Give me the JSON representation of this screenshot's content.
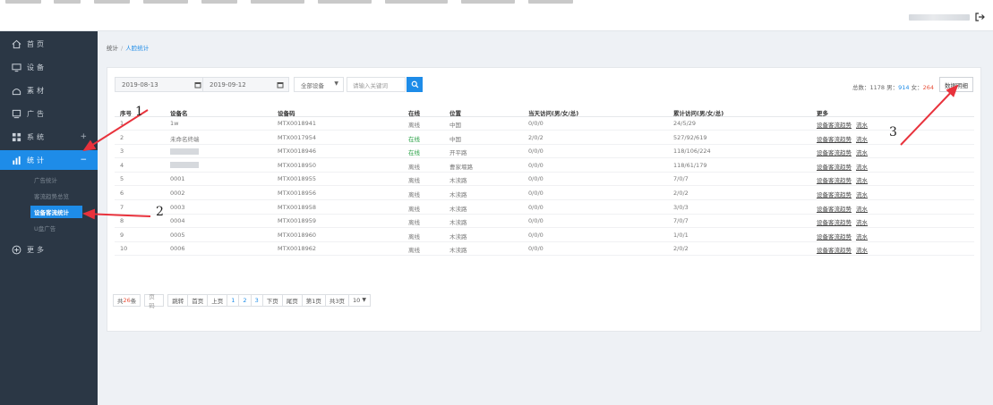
{
  "sidebar": {
    "items": [
      {
        "label": "首页",
        "icon": "home-icon"
      },
      {
        "label": "设备",
        "icon": "monitor-icon"
      },
      {
        "label": "素材",
        "icon": "image-icon"
      },
      {
        "label": "广告",
        "icon": "screen-icon"
      },
      {
        "label": "系统",
        "icon": "grid-icon",
        "toggle": "+"
      },
      {
        "label": "统计",
        "icon": "chart-icon",
        "toggle": "−",
        "active": true
      },
      {
        "label": "更多",
        "icon": "plus-circle-icon"
      }
    ],
    "stat_sub": [
      "广告统计",
      "客流趋势总览",
      "设备客流统计",
      "U盘广告"
    ]
  },
  "breadcrumb": {
    "parent": "统计",
    "separator": "/",
    "current": "人脸统计"
  },
  "filters": {
    "start_date": "2019-08-13",
    "end_date": "2019-09-12",
    "device_select": "全部设备",
    "search_placeholder": "请输入关键词"
  },
  "stats": {
    "total_label": "总数：",
    "total": "1178",
    "male_label": "男：",
    "male": "914",
    "female_label": "女：",
    "female": "264"
  },
  "detail_button": "数据明细",
  "table": {
    "headers": [
      "序号",
      "设备名",
      "设备码",
      "在线",
      "位置",
      "当天访问(男/女/总)",
      "累计访问(男/女/总)",
      "更多"
    ],
    "rows": [
      {
        "no": "1",
        "name": "1w",
        "code": "MTX0018941",
        "status": "离线",
        "location": "中国",
        "today": "0/0/0",
        "total": "24/5/29"
      },
      {
        "no": "2",
        "name": "未命名终端",
        "code": "MTX0017954",
        "status": "在线",
        "location": "中国",
        "today": "2/0/2",
        "total": "527/92/619"
      },
      {
        "no": "3",
        "name": "",
        "code": "MTX0018946",
        "status": "在线",
        "location": "开平路",
        "today": "0/0/0",
        "total": "118/106/224"
      },
      {
        "no": "4",
        "name": "",
        "code": "MTX0018950",
        "status": "离线",
        "location": "曹家堰路",
        "today": "0/0/0",
        "total": "118/61/179"
      },
      {
        "no": "5",
        "name": "0001",
        "code": "MTX0018955",
        "status": "离线",
        "location": "木渎路",
        "today": "0/0/0",
        "total": "7/0/7"
      },
      {
        "no": "6",
        "name": "0002",
        "code": "MTX0018956",
        "status": "离线",
        "location": "木渎路",
        "today": "0/0/0",
        "total": "2/0/2"
      },
      {
        "no": "7",
        "name": "0003",
        "code": "MTX0018958",
        "status": "离线",
        "location": "木渎路",
        "today": "0/0/0",
        "total": "3/0/3"
      },
      {
        "no": "8",
        "name": "0004",
        "code": "MTX0018959",
        "status": "离线",
        "location": "木渎路",
        "today": "0/0/0",
        "total": "7/0/7"
      },
      {
        "no": "9",
        "name": "0005",
        "code": "MTX0018960",
        "status": "离线",
        "location": "木渎路",
        "today": "0/0/0",
        "total": "1/0/1"
      },
      {
        "no": "10",
        "name": "0006",
        "code": "MTX0018962",
        "status": "离线",
        "location": "木渎路",
        "today": "0/0/0",
        "total": "2/0/2"
      }
    ],
    "link_trend": "设备客流趋势",
    "link_flow": "流水"
  },
  "pagination": {
    "total_prefix": "共",
    "total_count": "26",
    "total_suffix": "条",
    "page_input_placeholder": "页码",
    "jump": "跳转",
    "first": "首页",
    "prev": "上页",
    "pages": [
      "1",
      "2",
      "3"
    ],
    "next": "下页",
    "last": "尾页",
    "current_page": "第1页",
    "total_pages": "共3页",
    "page_size": "10"
  },
  "annotations": [
    "1",
    "2",
    "3"
  ],
  "colors": {
    "sidebar_bg": "#2b3745",
    "accent": "#1e8ce8",
    "online": "#2aa147",
    "female": "#e8523c",
    "arrow": "#e8323c"
  }
}
